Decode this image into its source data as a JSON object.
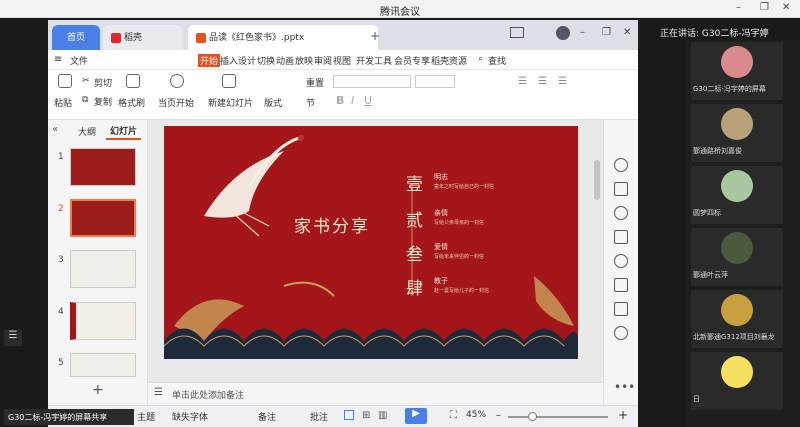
{
  "meeting": {
    "title": "腾讯会议",
    "speaking": "正在讲话: G30二标-冯宇婷",
    "sharer_label": "G30二标-冯宇婷的屏幕共享"
  },
  "tabs": {
    "home": "首页",
    "docer": "稻壳",
    "file": "品读《红色家书》.pptx"
  },
  "menu": [
    "开始",
    "插入",
    "设计",
    "切换",
    "动画",
    "放映",
    "审阅",
    "视图",
    "开发工具",
    "会员专享",
    "稻壳资源"
  ],
  "file_menu": "文件",
  "search": "查找",
  "toolbar": {
    "paste": "粘贴",
    "cut": "剪切",
    "copy": "复制",
    "format_painter": "格式刷",
    "play_from_current": "当页开始",
    "new_slide": "新建幻灯片",
    "layout": "版式",
    "section": "节",
    "reset": "重置"
  },
  "left_tabs": {
    "outline": "大纲",
    "slides": "幻灯片"
  },
  "slide_numbers": [
    "1",
    "2",
    "3",
    "4",
    "5"
  ],
  "slide": {
    "title": "家书分享",
    "items": [
      {
        "num": "壹",
        "name": "明志",
        "desc": "童年之时写给自己的一封信"
      },
      {
        "num": "贰",
        "name": "亲情",
        "desc": "写给父亲母亲的一封信"
      },
      {
        "num": "叁",
        "name": "爱情",
        "desc": "写给未来伴侣的一封信"
      },
      {
        "num": "肆",
        "name": "教子",
        "desc": "赵一曼写给儿子的一封信"
      }
    ]
  },
  "notes_placeholder": "单击此处添加备注",
  "status": {
    "theme": "Office 主题",
    "missing_font": "缺失字体",
    "notes": "备注",
    "comments": "批注",
    "zoom": "45%"
  },
  "participants": [
    {
      "name": "G30二标-冯宇婷的屏幕",
      "color": "#d98b8b"
    },
    {
      "name": "鄞通路桥刘嘉俊",
      "color": "#b8a27a"
    },
    {
      "name": "圆梦四标",
      "color": "#a8c8a0"
    },
    {
      "name": "鄞通叶云萍",
      "color": "#4a5a3a"
    },
    {
      "name": "北新鄞通G312项目刘襄龙",
      "color": "#c8a040"
    },
    {
      "name": "日",
      "color": "#f5e060"
    }
  ],
  "colors": {
    "accent": "#4a7fe6",
    "slide_bg": "#a5161b",
    "wps_orange": "#e8501e"
  }
}
